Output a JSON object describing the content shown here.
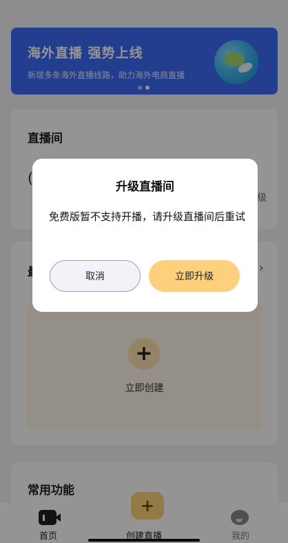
{
  "banner": {
    "title": "海外直播 强势上线",
    "subtitle": "新增多条海外直播线路，助力海外电商直播",
    "active_slide": 2,
    "slide_count": 2
  },
  "live_card": {
    "title": "直播间",
    "partial_text": "(",
    "partial_right": "级"
  },
  "recent_card": {
    "title_partial": "最",
    "arrow": "›",
    "create_icon": "+",
    "create_label": "立即创建"
  },
  "func_card": {
    "title": "常用功能"
  },
  "tabbar": {
    "home_label": "首页",
    "create_label": "创建直播",
    "create_icon": "+",
    "me_label": "我的"
  },
  "dialog": {
    "title": "升级直播间",
    "message": "免费版暂不支持开播，请升级直播间后重试",
    "cancel_label": "取消",
    "upgrade_label": "立即升级"
  },
  "colors": {
    "banner_bg": "#3d6bf5",
    "upgrade_button": "#ffd07c",
    "cancel_button": "#f1f3f8"
  }
}
